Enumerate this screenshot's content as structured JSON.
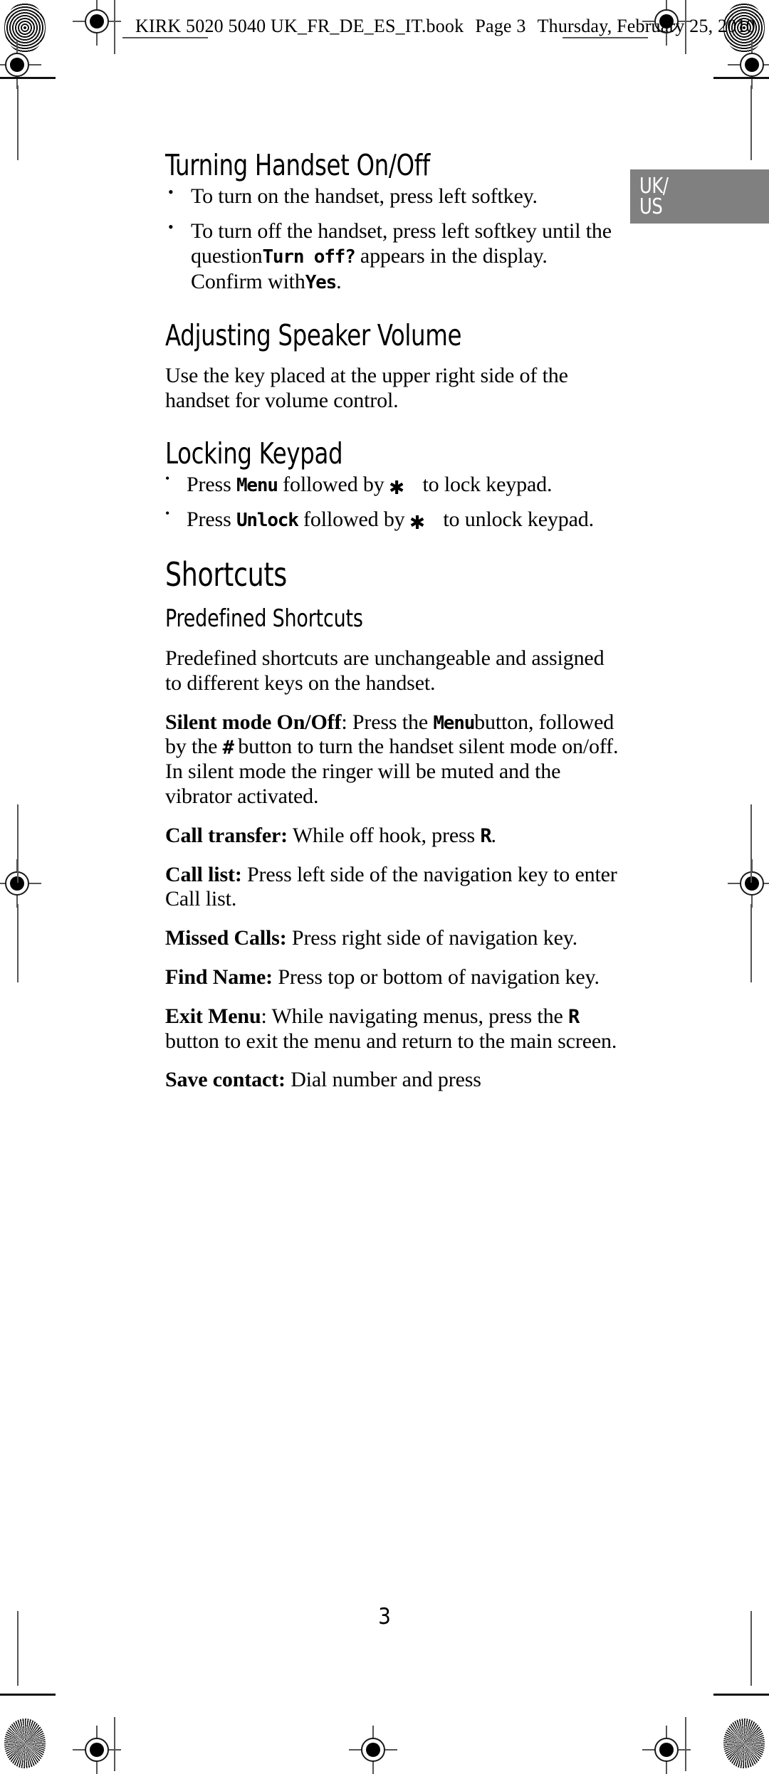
{
  "document": {
    "header_line": "KIRK 5020 5040 UK_FR_DE_ES_IT.book  Page 3  Thursday, February 25, 2010",
    "header_parts": {
      "book": "KIRK 5020 5040 UK_FR_DE_ES_IT.book",
      "page": "Page 3",
      "date": "Thursday, February 25, 2010"
    },
    "page_number": "3"
  },
  "region_tab": {
    "line1": "UK/",
    "line2": "US",
    "background_color": "#808080",
    "text_color": "#ffffff"
  },
  "sections": [
    {
      "id": "turning-handset-on-off",
      "heading": "Turning Handset On/Off",
      "bullets": [
        {
          "parts": [
            {
              "t": "To turn on the handset, press left softkey.",
              "style": "normal"
            }
          ]
        },
        {
          "parts": [
            {
              "t": "To turn off the handset, press left softkey until the question ",
              "style": "normal"
            },
            {
              "t": "Turn off?",
              "style": "lcd"
            },
            {
              "t": " appears in the display. Confirm with ",
              "style": "normal"
            },
            {
              "t": "Yes",
              "style": "lcd"
            },
            {
              "t": ".",
              "style": "normal"
            }
          ]
        }
      ]
    },
    {
      "id": "adjusting-speaker-volume",
      "heading": "Adjusting Speaker Volume",
      "paragraph": "Use the key placed at the upper right side of the handset for volume control."
    },
    {
      "id": "locking-keypad",
      "heading": "Locking Keypad",
      "bullets": [
        {
          "parts": [
            {
              "t": "Press ",
              "style": "normal"
            },
            {
              "t": "Menu",
              "style": "lcd"
            },
            {
              "t": " followed by ",
              "style": "normal"
            },
            {
              "t": "✱",
              "style": "lcd-star"
            },
            {
              "t": "to lock keypad.",
              "style": "normal"
            }
          ]
        },
        {
          "parts": [
            {
              "t": "Press ",
              "style": "normal"
            },
            {
              "t": "Unlock",
              "style": "lcd"
            },
            {
              "t": " followed by ",
              "style": "normal"
            },
            {
              "t": "✱",
              "style": "lcd-star"
            },
            {
              "t": "to unlock keypad.",
              "style": "normal"
            }
          ]
        }
      ]
    },
    {
      "id": "shortcuts",
      "heading": "Shortcuts",
      "subheading": "Predefined Shortcuts",
      "intro": "Predefined shortcuts are unchangeable and assigned to different keys on the handset.",
      "items": [
        {
          "label": "Silent mode On/Off",
          "separator": ": ",
          "parts": [
            {
              "t": "Press the ",
              "style": "normal"
            },
            {
              "t": "Menu",
              "style": "lcd"
            },
            {
              "t": " button, followed by the ",
              "style": "normal"
            },
            {
              "t": "#",
              "style": "lcd-hash"
            },
            {
              "t": " button to turn the handset silent mode on/off. In silent mode the ringer will be muted and the vibrator activated.",
              "style": "normal"
            }
          ]
        },
        {
          "label": "Call transfer:",
          "separator": " ",
          "parts": [
            {
              "t": "While off hook, press ",
              "style": "normal"
            },
            {
              "t": "R",
              "style": "lcd-r"
            },
            {
              "t": ".",
              "style": "normal"
            }
          ]
        },
        {
          "label": "Call list:",
          "separator": " ",
          "parts": [
            {
              "t": "Press left side of the navigation key to enter Call list.",
              "style": "normal"
            }
          ]
        },
        {
          "label": "Missed Calls:",
          "separator": " ",
          "parts": [
            {
              "t": "Press right side of navigation key.",
              "style": "normal"
            }
          ]
        },
        {
          "label": "Find Name:",
          "separator": " ",
          "parts": [
            {
              "t": "Press top or bottom of navigation key.",
              "style": "normal"
            }
          ]
        },
        {
          "label": "Exit Menu",
          "separator": ": ",
          "parts": [
            {
              "t": "While navigating menus, press the ",
              "style": "normal"
            },
            {
              "t": "R",
              "style": "lcd-r"
            },
            {
              "t": " button to exit the menu and return to the main screen.",
              "style": "normal"
            }
          ]
        },
        {
          "label": "Save contact:",
          "separator": " ",
          "parts": [
            {
              "t": "Dial number and press",
              "style": "normal"
            }
          ]
        }
      ]
    }
  ]
}
